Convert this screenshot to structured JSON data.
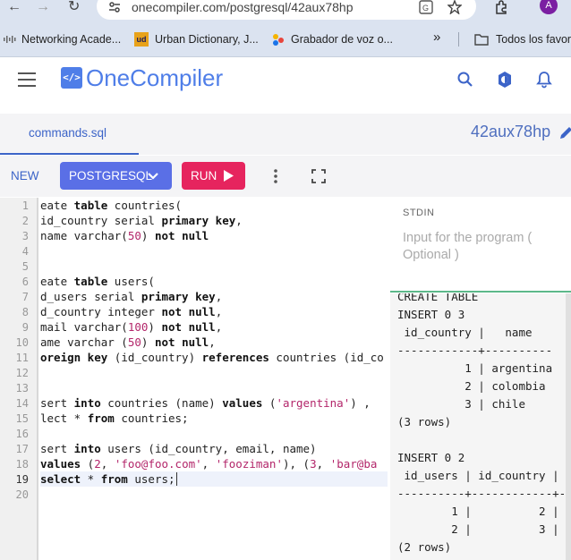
{
  "browser": {
    "url": "onecompiler.com/postgresql/42aux78hp",
    "avatar_letter": "A"
  },
  "bookmarks": [
    {
      "label": "Networking Acade..."
    },
    {
      "label": "Urban Dictionary, J..."
    },
    {
      "label": "Grabador de voz o..."
    },
    {
      "label": "Todos los favori"
    }
  ],
  "header": {
    "logo_icon": "</>",
    "logo_text": "OneCompiler"
  },
  "tab": {
    "filename": "commands.sql",
    "code_id": "42aux78hp"
  },
  "toolbar": {
    "new_label": "NEW",
    "language_label": "POSTGRESQL",
    "run_label": "RUN"
  },
  "editor": {
    "line_numbers": [
      "1",
      "2",
      "3",
      "4",
      "5",
      "6",
      "7",
      "8",
      "9",
      "10",
      "11",
      "12",
      "13",
      "14",
      "15",
      "16",
      "17",
      "18",
      "19",
      "20"
    ],
    "active_line": 19
  },
  "stdin": {
    "label": "STDIN",
    "placeholder": "Input for the program ( Optional )"
  },
  "output": {
    "lines": [
      "CREATE TABLE",
      "INSERT 0 3",
      " id_country |   name",
      "------------+----------",
      "          1 | argentina",
      "          2 | colombia",
      "          3 | chile",
      "(3 rows)",
      "",
      "INSERT 0 2",
      " id_users | id_country |",
      "----------+------------+-",
      "        1 |          2 |",
      "        2 |          3 |",
      "(2 rows)"
    ]
  },
  "colors": {
    "brand": "#4f7ee8",
    "run": "#e6245e",
    "language_button": "#5a6fe6"
  }
}
